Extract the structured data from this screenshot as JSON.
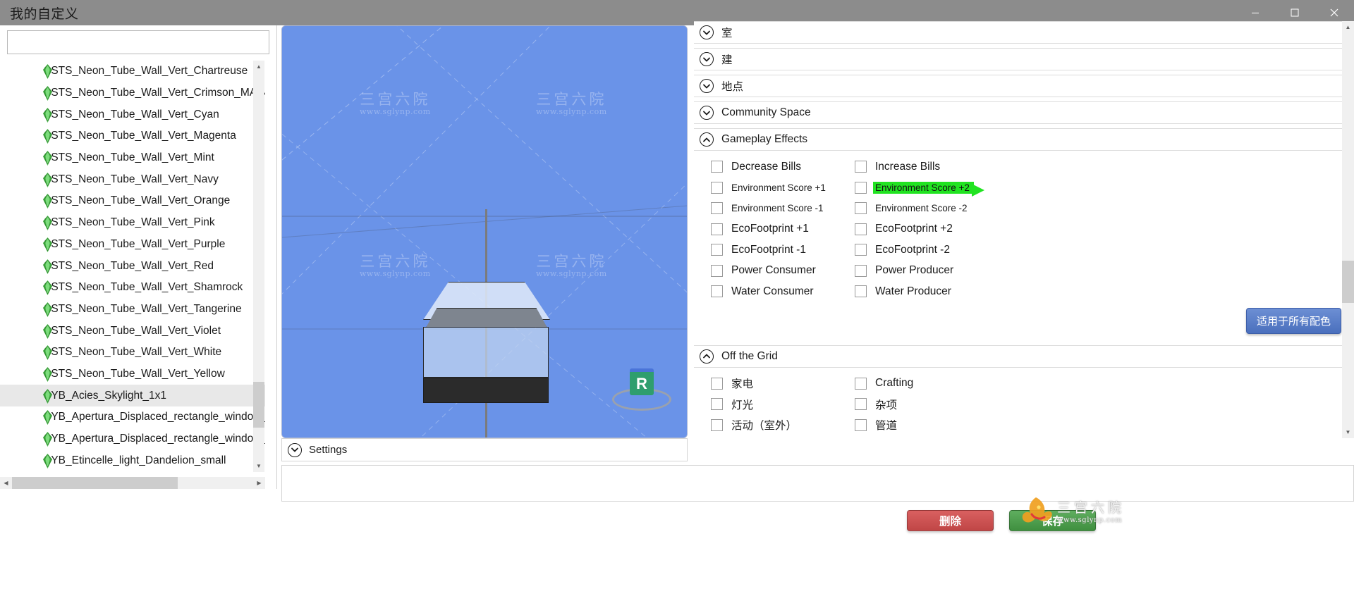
{
  "window": {
    "title": "我的自定义",
    "minimize_icon": "minimize-icon",
    "maximize_icon": "maximize-icon",
    "close_icon": "close-icon"
  },
  "left_panel": {
    "search_value": "",
    "search_placeholder": "",
    "items": [
      {
        "label": "SSTS_Neon_Tube_Wall_Vert_Chartreuse",
        "selected": false
      },
      {
        "label": "SSTS_Neon_Tube_Wall_Vert_Crimson_MAIN",
        "selected": false
      },
      {
        "label": "SSTS_Neon_Tube_Wall_Vert_Cyan",
        "selected": false
      },
      {
        "label": "SSTS_Neon_Tube_Wall_Vert_Magenta",
        "selected": false
      },
      {
        "label": "SSTS_Neon_Tube_Wall_Vert_Mint",
        "selected": false
      },
      {
        "label": "SSTS_Neon_Tube_Wall_Vert_Navy",
        "selected": false
      },
      {
        "label": "SSTS_Neon_Tube_Wall_Vert_Orange",
        "selected": false
      },
      {
        "label": "SSTS_Neon_Tube_Wall_Vert_Pink",
        "selected": false
      },
      {
        "label": "SSTS_Neon_Tube_Wall_Vert_Purple",
        "selected": false
      },
      {
        "label": "SSTS_Neon_Tube_Wall_Vert_Red",
        "selected": false
      },
      {
        "label": "SSTS_Neon_Tube_Wall_Vert_Shamrock",
        "selected": false
      },
      {
        "label": "SSTS_Neon_Tube_Wall_Vert_Tangerine",
        "selected": false
      },
      {
        "label": "SSTS_Neon_Tube_Wall_Vert_Violet",
        "selected": false
      },
      {
        "label": "SSTS_Neon_Tube_Wall_Vert_White",
        "selected": false
      },
      {
        "label": "SSTS_Neon_Tube_Wall_Vert_Yellow",
        "selected": false
      },
      {
        "label": "SYB_Acies_Skylight_1x1",
        "selected": true
      },
      {
        "label": "SYB_Apertura_Displaced_rectangle_window_m",
        "selected": false
      },
      {
        "label": "SYB_Apertura_Displaced_rectangle_window_m",
        "selected": false
      },
      {
        "label": "SYB_Etincelle_light_Dandelion_small",
        "selected": false
      }
    ],
    "item_icon": "plumbob-icon",
    "scroll_up_icon": "scroll-up-arrow-icon",
    "scroll_down_icon": "scroll-down-arrow-icon",
    "scroll_left_icon": "scroll-left-arrow-icon",
    "scroll_right_icon": "scroll-right-arrow-icon"
  },
  "viewport": {
    "nav_gizmo_label": "R",
    "watermark_cn": "三宫六院",
    "watermark_url": "www.sglynp.com",
    "settings_label": "Settings",
    "settings_chevron": "chevron-down-icon",
    "background_color": "#6a93e8"
  },
  "right_panel": {
    "sections": [
      {
        "id": "room",
        "label": "室",
        "expanded": false,
        "chevron": "chevron-down-icon"
      },
      {
        "id": "build",
        "label": "建",
        "expanded": false,
        "chevron": "chevron-down-icon"
      },
      {
        "id": "location",
        "label": "地点",
        "expanded": false,
        "chevron": "chevron-down-icon"
      },
      {
        "id": "community",
        "label": "Community Space",
        "expanded": false,
        "chevron": "chevron-down-icon"
      },
      {
        "id": "gameplay",
        "label": "Gameplay Effects",
        "expanded": true,
        "chevron": "chevron-up-icon"
      },
      {
        "id": "offgrid",
        "label": "Off the Grid",
        "expanded": true,
        "chevron": "chevron-up-icon"
      }
    ],
    "gameplay_effects": [
      {
        "label": "Decrease Bills",
        "checked": false,
        "small": false,
        "highlighted": false
      },
      {
        "label": "Increase Bills",
        "checked": false,
        "small": false,
        "highlighted": false
      },
      {
        "label": "Environment Score +1",
        "checked": false,
        "small": true,
        "highlighted": false
      },
      {
        "label": "Environment Score +2",
        "checked": false,
        "small": true,
        "highlighted": true
      },
      {
        "label": "Environment Score -1",
        "checked": false,
        "small": true,
        "highlighted": false
      },
      {
        "label": "Environment Score -2",
        "checked": false,
        "small": true,
        "highlighted": false
      },
      {
        "label": "EcoFootprint +1",
        "checked": false,
        "small": false,
        "highlighted": false
      },
      {
        "label": "EcoFootprint +2",
        "checked": false,
        "small": false,
        "highlighted": false
      },
      {
        "label": "EcoFootprint -1",
        "checked": false,
        "small": false,
        "highlighted": false
      },
      {
        "label": "EcoFootprint -2",
        "checked": false,
        "small": false,
        "highlighted": false
      },
      {
        "label": "Power Consumer",
        "checked": false,
        "small": false,
        "highlighted": false
      },
      {
        "label": "Power Producer",
        "checked": false,
        "small": false,
        "highlighted": false
      },
      {
        "label": "Water Consumer",
        "checked": false,
        "small": false,
        "highlighted": false
      },
      {
        "label": "Water Producer",
        "checked": false,
        "small": false,
        "highlighted": false
      }
    ],
    "off_the_grid": [
      {
        "label": "家电",
        "checked": false,
        "small": false,
        "highlighted": false
      },
      {
        "label": "Crafting",
        "checked": false,
        "small": false,
        "highlighted": false
      },
      {
        "label": "灯光",
        "checked": false,
        "small": false,
        "highlighted": false
      },
      {
        "label": "杂项",
        "checked": false,
        "small": false,
        "highlighted": false
      },
      {
        "label": "活动（室外）",
        "checked": false,
        "small": false,
        "highlighted": false
      },
      {
        "label": "管道",
        "checked": false,
        "small": false,
        "highlighted": false
      }
    ],
    "apply_all_label": "适用于所有配色",
    "scroll_up_icon": "scroll-up-arrow-icon",
    "scroll_down_icon": "scroll-down-arrow-icon"
  },
  "footer": {
    "notes_value": "",
    "delete_label": "删除",
    "save_label": "保存",
    "watermark_cn": "三宫六院",
    "watermark_url": "www.sglynp.com",
    "delete_color": "#c94b4b",
    "save_color": "#4a9a4a"
  }
}
